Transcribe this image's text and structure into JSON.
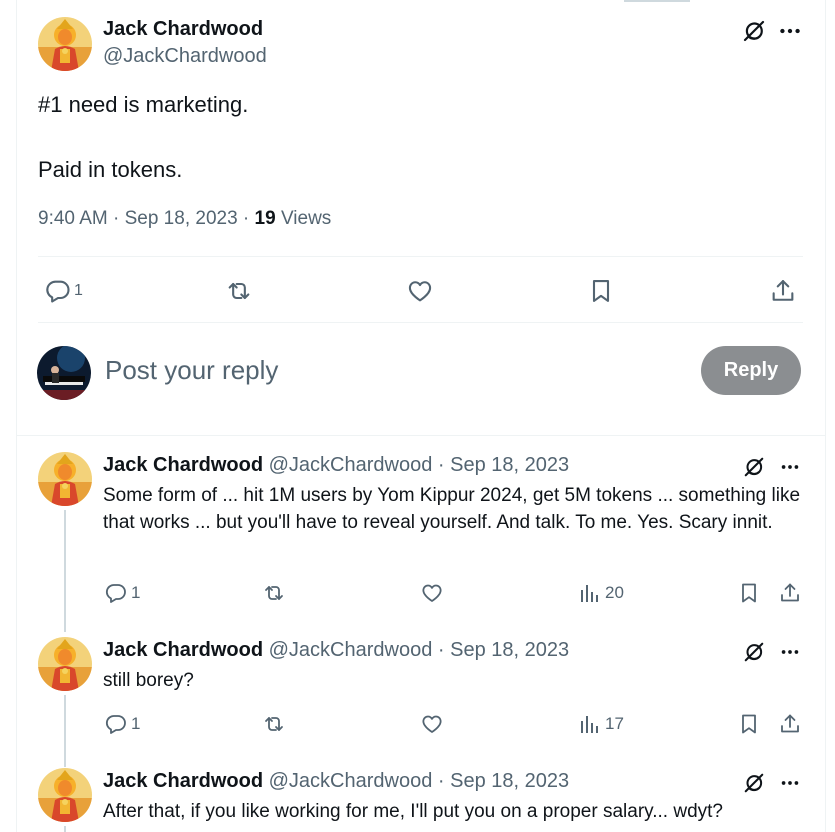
{
  "main_tweet": {
    "author_name": "Jack Chardwood",
    "author_handle": "@JackChardwood",
    "text_line1": "#1 need is marketing.",
    "text_line2": "Paid in tokens.",
    "time": "9:40 AM · Sep 18, 2023 · ",
    "views_count": "19",
    "views_label": " Views",
    "reply_count": "1",
    "icons": [
      "reply-icon",
      "retweet-icon",
      "like-icon",
      "bookmark-icon",
      "share-icon",
      "grok-icon",
      "more-icon"
    ]
  },
  "composer": {
    "placeholder": "Post your reply",
    "button_label": "Reply",
    "button_color": "#8b8e91"
  },
  "replies": [
    {
      "author_name": "Jack Chardwood",
      "author_handle": "@JackChardwood",
      "date": "· Sep 18, 2023",
      "text": "Some form of ... hit 1M users by Yom Kippur 2024, get 5M tokens ... something like that works ... but you'll have to reveal yourself. And talk. To me. Yes. Scary innit.",
      "reply_count": "1",
      "views": "20"
    },
    {
      "author_name": "Jack Chardwood",
      "author_handle": "@JackChardwood",
      "date": "· Sep 18, 2023",
      "text": "still borey?",
      "reply_count": "1",
      "views": "17"
    },
    {
      "author_name": "Jack Chardwood",
      "author_handle": "@JackChardwood",
      "date": "· Sep 18, 2023",
      "text": "After that, if you like working for me, I'll put you on a proper salary... wdyt?"
    }
  ],
  "colors": {
    "text": "#0f1419",
    "secondary": "#536471",
    "border": "#eff3f4",
    "thread": "#cfd9de"
  }
}
